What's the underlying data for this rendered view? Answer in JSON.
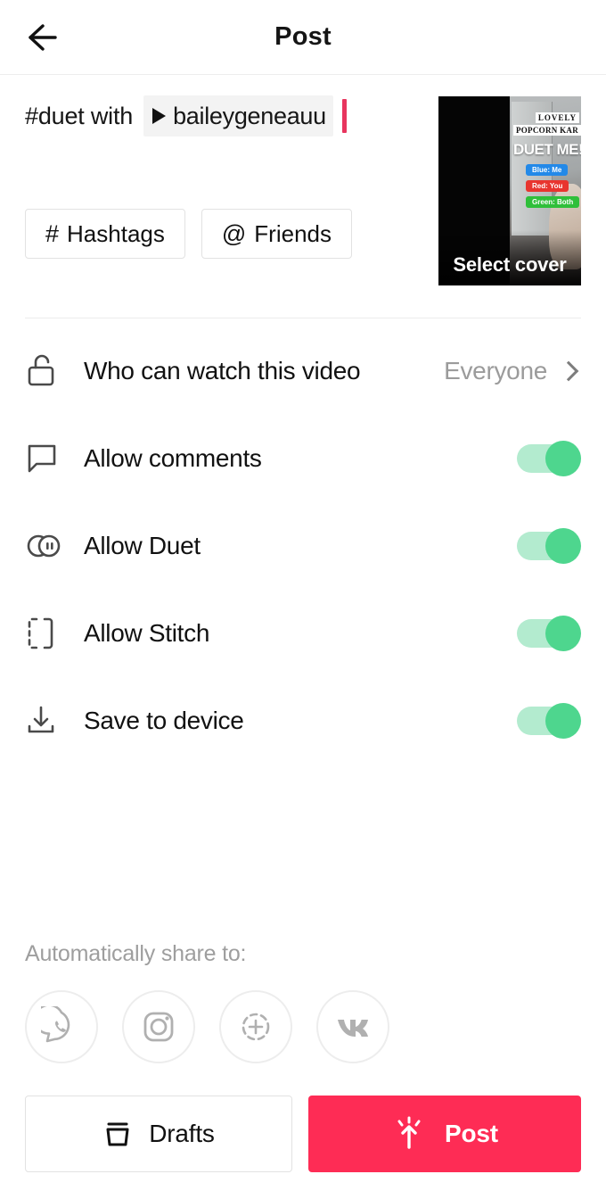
{
  "header": {
    "title": "Post",
    "back_icon": "arrow-left-icon"
  },
  "caption": {
    "prefix_text": "#duet with",
    "mention_icon": "play-triangle-icon",
    "mention_name": "baileygeneauu",
    "caret_color": "#e8355e"
  },
  "tag_buttons": [
    {
      "symbol": "#",
      "label": "Hashtags",
      "icon": "hashtag-icon"
    },
    {
      "symbol": "@",
      "label": "Friends",
      "icon": "at-mention-icon"
    }
  ],
  "cover": {
    "select_cover_label": "Select cover",
    "overlays": {
      "lovely": "LOVELY",
      "popcorn": "POPCORN KAR",
      "duet_me": "DUET ME!!!",
      "tag_blue": "Blue: Me",
      "tag_red": "Red: You",
      "tag_green": "Green: Both"
    },
    "colors": {
      "blue": "#2389e8",
      "red": "#e8352f",
      "green": "#2fbf3a"
    }
  },
  "settings": {
    "privacy": {
      "icon": "unlock-icon",
      "label": "Who can watch this video",
      "value": "Everyone",
      "chevron_icon": "chevron-right-icon"
    },
    "toggles": [
      {
        "icon": "comment-bubble-icon",
        "label": "Allow comments",
        "state": "on"
      },
      {
        "icon": "duet-circles-icon",
        "label": "Allow Duet",
        "state": "on"
      },
      {
        "icon": "stitch-bracket-icon",
        "label": "Allow Stitch",
        "state": "on"
      },
      {
        "icon": "download-icon",
        "label": "Save to device",
        "state": "on"
      }
    ],
    "toggle_colors": {
      "track": "#b3ebcf",
      "thumb": "#4ed68e"
    }
  },
  "share": {
    "label": "Automatically share to:",
    "targets": [
      {
        "icon": "whatsapp-icon",
        "name": "WhatsApp"
      },
      {
        "icon": "instagram-icon",
        "name": "Instagram"
      },
      {
        "icon": "instagram-story-icon",
        "name": "Instagram Story"
      },
      {
        "icon": "vk-icon",
        "name": "VK"
      }
    ]
  },
  "bottom_bar": {
    "drafts": {
      "label": "Drafts",
      "icon": "drafts-box-icon"
    },
    "post": {
      "label": "Post",
      "icon": "post-upload-icon",
      "color": "#fe2c55"
    }
  }
}
